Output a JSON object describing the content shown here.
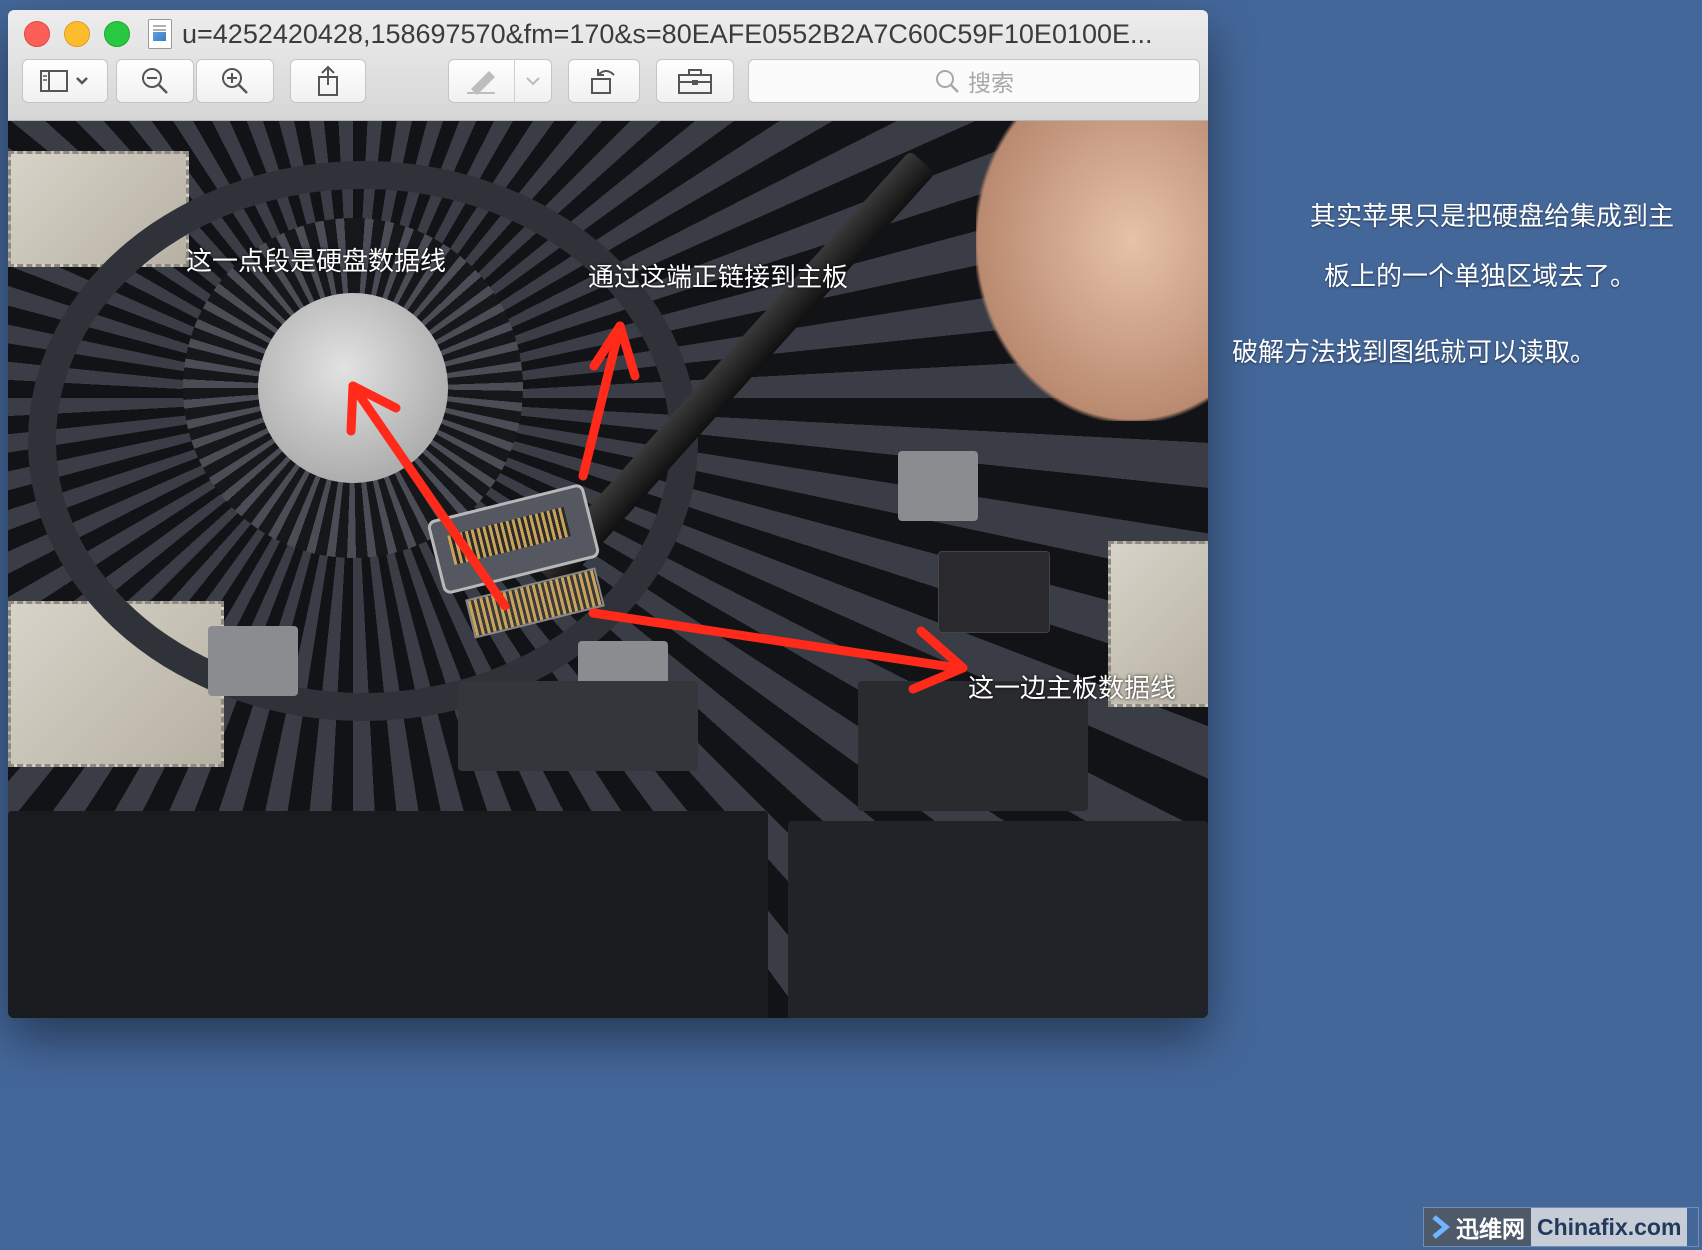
{
  "window": {
    "title": "u=4252420428,158697570&fm=170&s=80EAFE0552B2A7C60C59F10E0100E...",
    "search_placeholder": "搜索"
  },
  "toolbar": {
    "sidebar_icon": "sidebar-icon",
    "zoom_out_icon": "zoom-out-icon",
    "zoom_in_icon": "zoom-in-icon",
    "share_icon": "share-icon",
    "markup_icon": "markup-pen-icon",
    "rotate_icon": "rotate-icon",
    "toolbox_icon": "toolbox-icon",
    "search_icon": "search-icon"
  },
  "image": {
    "annotations": {
      "fan_label": "这一点段是硬盘数据线",
      "connector_label": "通过这端正链接到主板",
      "board_label": "这一边主板数据线"
    }
  },
  "desktop": {
    "note_line1": "其实苹果只是把硬盘给集成到主",
    "note_line2": "板上的一个单独区域去了。",
    "note_line3": "破解方法找到图纸就可以读取。"
  },
  "watermark": {
    "left": "迅维网",
    "right": "Chinafix.com"
  },
  "colors": {
    "desktop_bg": "#44679a",
    "arrow": "#ff2a1a"
  }
}
